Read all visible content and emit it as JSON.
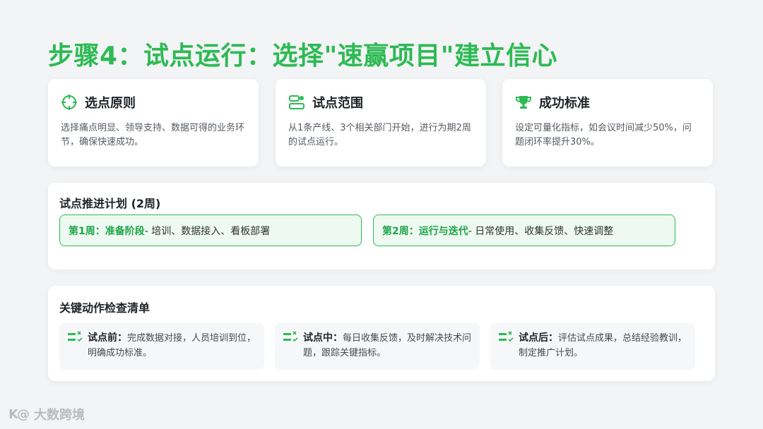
{
  "title": "步骤4：试点运行：选择\"速赢项目\"建立信心",
  "cards": [
    {
      "icon": "target-icon",
      "title": "选点原则",
      "desc": "选择痛点明显、领导支持、数据可得的业务环节，确保快速成功。"
    },
    {
      "icon": "scope-icon",
      "title": "试点范围",
      "desc": "从1条产线、3个相关部门开始，进行为期2周的试点运行。"
    },
    {
      "icon": "trophy-icon",
      "title": "成功标准",
      "desc": "设定可量化指标，如会议时间减少50%，问题闭环率提升30%。"
    }
  ],
  "plan": {
    "title": "试点推进计划 (2周)",
    "phases": [
      {
        "label": "第1周：准备阶段",
        "desc": "- 培训、数据接入、看板部署"
      },
      {
        "label": "第2周：运行与迭代",
        "desc": "- 日常使用、收集反馈、快速调整"
      }
    ]
  },
  "checklist": {
    "title": "关键动作检查清单",
    "items": [
      {
        "label": "试点前：",
        "desc": "完成数据对接，人员培训到位，明确成功标准。"
      },
      {
        "label": "试点中：",
        "desc": "每日收集反馈，及时解决技术问题，跟踪关键指标。"
      },
      {
        "label": "试点后：",
        "desc": "评估试点成果，总结经验教训，制定推广计划。"
      }
    ]
  },
  "logo": {
    "mark": "K@",
    "text": "大数跨境"
  },
  "colors": {
    "accent": "#2dba54",
    "accent_bg": "#eefaf1"
  }
}
